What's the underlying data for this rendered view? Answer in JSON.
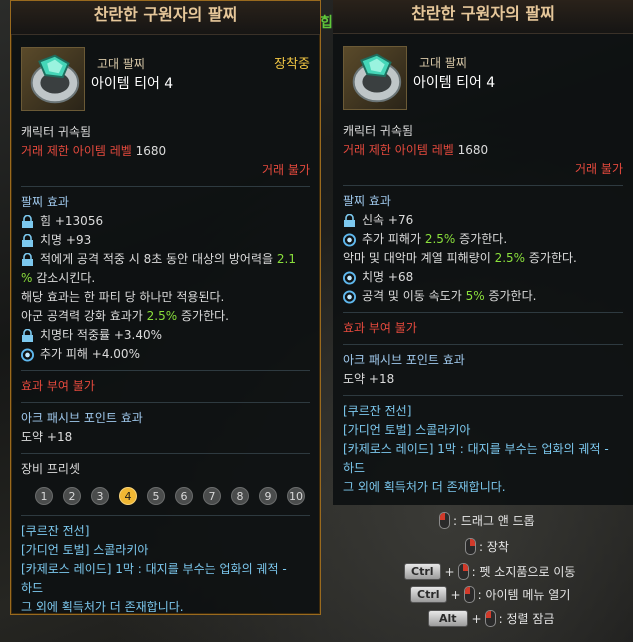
{
  "background": {
    "partial_text": "힙"
  },
  "left": {
    "title": "찬란한 구원자의 팔찌",
    "grade": "고대 팔찌",
    "tier": "아이템 티어 4",
    "equipped": "장착중",
    "bound": "캐릭터 귀속됨",
    "level_label": "거래 제한 아이템 레벨",
    "level_value": "1680",
    "trade": "거래 불가",
    "effect_header": "팔찌 효과",
    "effects": [
      {
        "icon": "lock-icon",
        "text": "힘 +13056"
      },
      {
        "icon": "lock-icon",
        "text": "치명 +93"
      }
    ],
    "long_effect": {
      "pre": "적에게 공격 적중 시 8초 동안 대상의 방어력을 ",
      "val": "2.1",
      "rest_line": "%",
      "post": " 감소시킨다."
    },
    "party_note": "해당 효과는 한 파티 당 하나만 적용된다.",
    "ally": {
      "pre": "아군 공격력 강화 효과가 ",
      "val": "2.5%",
      "post": " 증가한다."
    },
    "effects2": [
      {
        "icon": "lock-icon",
        "text": "치명타 적중률 +3.40%"
      },
      {
        "icon": "swirl-icon",
        "text": "추가 피해 +4.00%"
      }
    ],
    "no_grant": "효과 부여 불가",
    "ark_header": "아크 패시브 포인트 효과",
    "ark_value": "도약 +18",
    "preset_label": "장비 프리셋",
    "presets": [
      "1",
      "2",
      "3",
      "4",
      "5",
      "6",
      "7",
      "8",
      "9",
      "10"
    ],
    "active_preset": "4",
    "sources": [
      "[쿠르잔 전선]",
      "[가디언 토벌] 스콜라키아",
      "[카제로스 레이드] 1막 : 대지를 부수는 업화의 궤적 -",
      "하드"
    ],
    "more": "그 외에 획득처가 더 존재합니다."
  },
  "right": {
    "title": "찬란한 구원자의 팔찌",
    "grade": "고대 팔찌",
    "tier": "아이템 티어 4",
    "bound": "캐릭터 귀속됨",
    "level_label": "거래 제한 아이템 레벨",
    "level_value": "1680",
    "trade": "거래 불가",
    "effect_header": "팔찌 효과",
    "eff1": {
      "icon": "lock-icon",
      "text": "신속 +76"
    },
    "eff2": {
      "icon": "swirl-icon",
      "pre": "추가 피해가 ",
      "val": "2.5%",
      "post": " 증가한다."
    },
    "eff3": {
      "pre": "악마 및 대악마 계열 피해량이 ",
      "val": "2.5%",
      "post": " 증가한다."
    },
    "eff4": {
      "icon": "swirl-icon",
      "text": "치명 +68"
    },
    "eff5": {
      "icon": "swirl-icon",
      "pre": "공격 및 이동 속도가 ",
      "val": "5%",
      "post": " 증가한다."
    },
    "no_grant": "효과 부여 불가",
    "ark_header": "아크 패시브 포인트 효과",
    "ark_value": "도약 +18",
    "sources": [
      "[쿠르잔 전선]",
      "[가디언 토벌] 스콜라키아",
      "[카제로스 레이드] 1막 : 대지를 부수는 업화의 궤적 -",
      "하드"
    ],
    "more": "그 외에 획득처가 더 존재합니다."
  },
  "controls": {
    "drag": ": 드래그 앤 드롭",
    "equip": ": 장착",
    "ctrl": "Ctrl",
    "pet_move": ": 펫 소지품으로 이동",
    "menu_open": ": 아이템 메뉴 열기",
    "alt": "Alt",
    "sort_lock": ": 정렬 잠금",
    "plus": "+"
  }
}
